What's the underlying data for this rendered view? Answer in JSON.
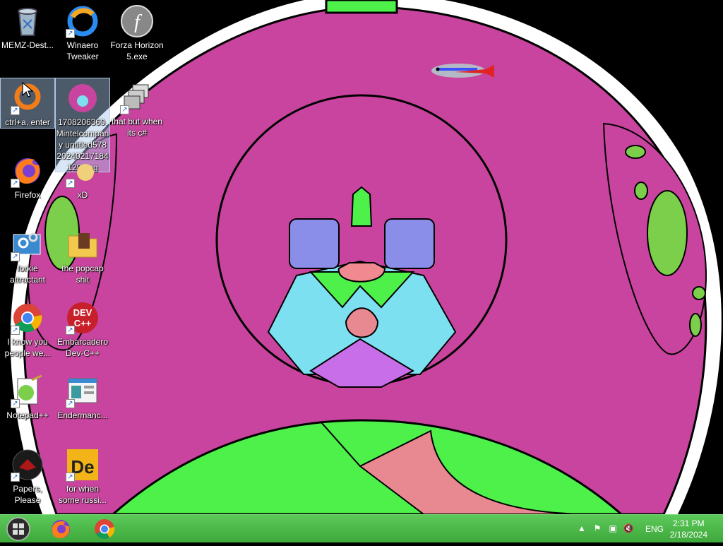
{
  "desktop": {
    "icons": [
      {
        "label": "MEMZ-Dest...",
        "icon": "recycle-bin-icon"
      },
      {
        "label": "Winaero Tweaker",
        "icon": "winaero-icon"
      },
      {
        "label": "Forza Horizon 5.exe",
        "icon": "flash-icon"
      },
      {
        "label": "ctrl+a, enter",
        "icon": "orange-ring-icon"
      },
      {
        "label": "1708206360.Mintelcompany untitled578 20240217184129.png",
        "icon": "image-file-icon"
      },
      {
        "label": "that but when its c#",
        "icon": "stacked-windows-icon"
      },
      {
        "label": "Firefox",
        "icon": "firefox-icon"
      },
      {
        "label": "xD",
        "icon": "xd-icon"
      },
      {
        "label": "forkie attractant",
        "icon": "settings-window-icon"
      },
      {
        "label": "the popcap shit",
        "icon": "folder-icon"
      },
      {
        "label": "I know you people we...",
        "icon": "chrome-icon"
      },
      {
        "label": "Embarcadero Dev-C++",
        "icon": "devcpp-icon"
      },
      {
        "label": "Notepad++",
        "icon": "notepadpp-icon"
      },
      {
        "label": "Endermanc...",
        "icon": "app-window-icon"
      },
      {
        "label": "Papers, Please",
        "icon": "papers-please-icon"
      },
      {
        "label": "for when some russi...",
        "icon": "de-icon"
      }
    ]
  },
  "taskbar": {
    "pinned": [
      "firefox-icon",
      "chrome-icon"
    ],
    "tray": {
      "icons": [
        "show-hidden-icons-chevron",
        "action-center-flag-icon",
        "network-icon",
        "volume-muted-icon"
      ],
      "language": "ENG",
      "time": "2:31 PM",
      "date": "2/18/2024"
    },
    "color": "#4cb84a"
  },
  "wallpaper": {
    "primary": "#c8449e",
    "accent": "#4ef04a",
    "background": "#000000"
  }
}
